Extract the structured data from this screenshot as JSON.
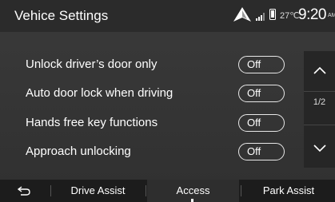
{
  "header": {
    "title": "Vehice Settings",
    "temperature": "27℃",
    "time": "9:20",
    "ampm": "AM"
  },
  "settings": [
    {
      "label": "Unlock driver’s door only",
      "value": "Off"
    },
    {
      "label": "Auto door lock when driving",
      "value": "Off"
    },
    {
      "label": "Hands free key functions",
      "value": "Off"
    },
    {
      "label": "Approach unlocking",
      "value": "Off"
    }
  ],
  "pager": {
    "indicator": "1/2"
  },
  "tabs": {
    "drive_assist": "Drive Assist",
    "access": "Access",
    "park_assist": "Park Assist",
    "active": "Access"
  },
  "icons": {
    "nav": "navigation-arrow-icon",
    "signal": "signal-bars-icon",
    "phone": "phone-icon",
    "back": "back-arrow-icon",
    "up": "chevron-up-icon",
    "down": "chevron-down-icon"
  }
}
